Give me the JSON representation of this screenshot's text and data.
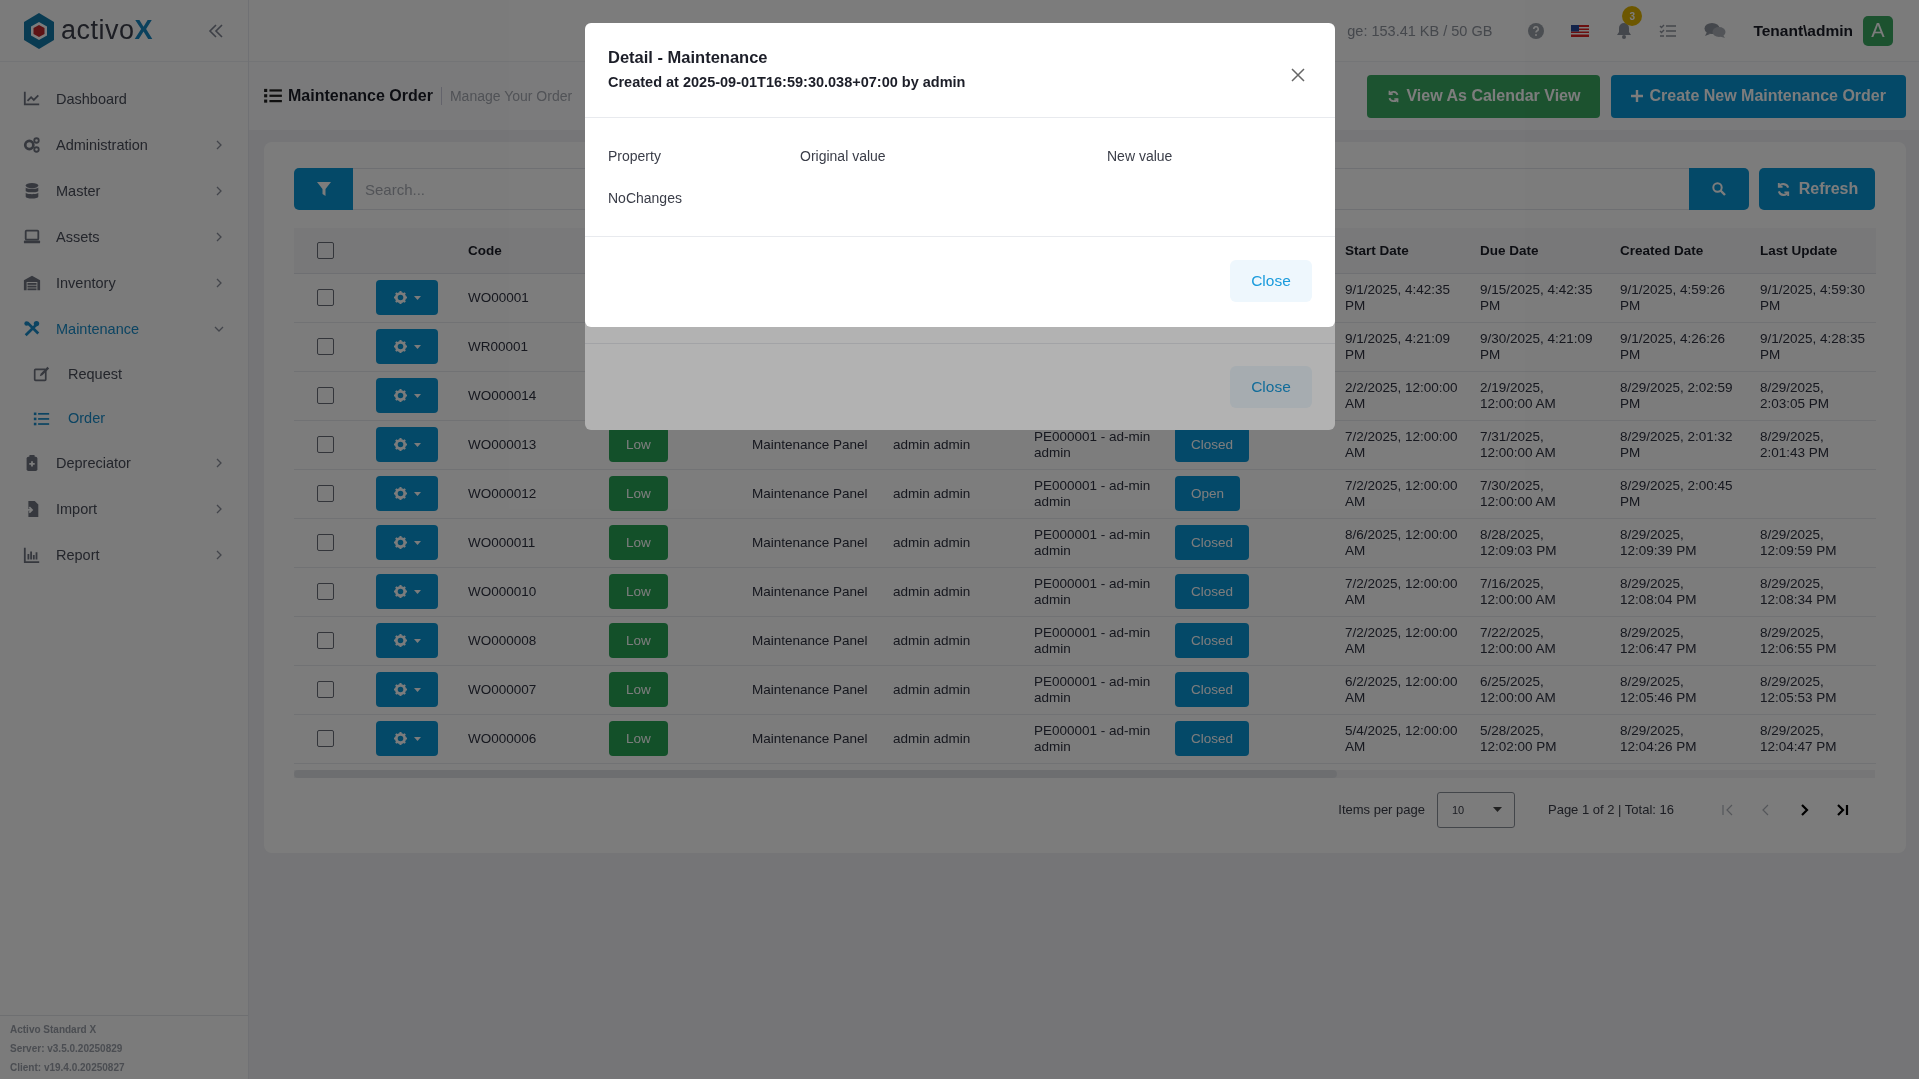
{
  "sidebar": {
    "logo": {
      "text": "activo",
      "accent": "X"
    },
    "items": [
      {
        "label": "Dashboard",
        "selected": false
      },
      {
        "label": "Administration",
        "selected": false,
        "expanded": false
      },
      {
        "label": "Master",
        "selected": false,
        "expanded": false
      },
      {
        "label": "Assets",
        "selected": false,
        "expanded": false
      },
      {
        "label": "Inventory",
        "selected": false,
        "expanded": false
      },
      {
        "label": "Maintenance",
        "selected": true,
        "expanded": true,
        "children": [
          {
            "label": "Request",
            "selected": false
          },
          {
            "label": "Order",
            "selected": true
          }
        ]
      },
      {
        "label": "Depreciator",
        "selected": false,
        "expanded": false
      },
      {
        "label": "Import",
        "selected": false,
        "expanded": false
      },
      {
        "label": "Report",
        "selected": false,
        "expanded": false
      }
    ],
    "footer": [
      "Activo Standard X",
      "Server: v3.5.0.20250829",
      "Client: v19.4.0.20250827"
    ]
  },
  "header": {
    "storage": "ge: 153.41 KB / 50 GB",
    "notifications": "3",
    "user": "Tenant\\admin",
    "avatar": "A"
  },
  "page": {
    "title": "Maintenance Order",
    "subtitle": "Manage Your Order",
    "buttons": [
      {
        "label": "View As Calendar View",
        "kind": "calendar"
      },
      {
        "label": "Create New Maintenance Order",
        "kind": "create"
      }
    ]
  },
  "toolbar": {
    "placeholder": "Search...",
    "refresh": "Refresh"
  },
  "table": {
    "select_all": {
      "checked": false
    },
    "code_column": "Code",
    "date_columns": [
      "Start Date",
      "Due Date",
      "Created Date",
      "Last Update"
    ],
    "rows": [
      {
        "checked": false,
        "code": "WO00001",
        "start": "9/1/2025, 4:42:35 PM",
        "due": "9/15/2025, 4:42:35 PM",
        "created": "9/1/2025, 4:59:26 PM",
        "updated": "9/1/2025, 4:59:30 PM"
      },
      {
        "checked": false,
        "code": "WR00001",
        "start": "9/1/2025, 4:21:09 PM",
        "due": "9/30/2025, 4:21:09 PM",
        "created": "9/1/2025, 4:26:26 PM",
        "updated": "9/1/2025, 4:28:35 PM"
      },
      {
        "checked": false,
        "code": "WO000014",
        "start": "2/2/2025, 12:00:00 AM",
        "due": "2/19/2025, 12:00:00 AM",
        "created": "8/29/2025, 2:02:59 PM",
        "updated": "8/29/2025, 2:03:05 PM"
      },
      {
        "checked": false,
        "code": "WO000013",
        "priority": "Low",
        "type": "Maintenance Panel",
        "requester": "admin admin",
        "assignee": "PE000001 - ad-min admin",
        "status": "Closed",
        "start": "7/2/2025, 12:00:00 AM",
        "due": "7/31/2025, 12:00:00 AM",
        "created": "8/29/2025, 2:01:32 PM",
        "updated": "8/29/2025, 2:01:43 PM"
      },
      {
        "checked": false,
        "code": "WO000012",
        "priority": "Low",
        "type": "Maintenance Panel",
        "requester": "admin admin",
        "assignee": "PE000001 - ad-min admin",
        "status": "Open",
        "start": "7/2/2025, 12:00:00 AM",
        "due": "7/30/2025, 12:00:00 AM",
        "created": "8/29/2025, 2:00:45 PM"
      },
      {
        "checked": false,
        "code": "WO000011",
        "priority": "Low",
        "type": "Maintenance Panel",
        "requester": "admin admin",
        "assignee": "PE000001 - ad-min admin",
        "status": "Closed",
        "start": "8/6/2025, 12:00:00 AM",
        "due": "8/28/2025, 12:09:03 PM",
        "created": "8/29/2025, 12:09:39 PM",
        "updated": "8/29/2025, 12:09:59 PM"
      },
      {
        "checked": false,
        "code": "WO000010",
        "priority": "Low",
        "type": "Maintenance Panel",
        "requester": "admin admin",
        "assignee": "PE000001 - ad-min admin",
        "status": "Closed",
        "start": "7/2/2025, 12:00:00 AM",
        "due": "7/16/2025, 12:00:00 AM",
        "created": "8/29/2025, 12:08:04 PM",
        "updated": "8/29/2025, 12:08:34 PM"
      },
      {
        "checked": false,
        "code": "WO000008",
        "priority": "Low",
        "type": "Maintenance Panel",
        "requester": "admin admin",
        "assignee": "PE000001 - ad-min admin",
        "status": "Closed",
        "start": "7/2/2025, 12:00:00 AM",
        "due": "7/22/2025, 12:00:00 AM",
        "created": "8/29/2025, 12:06:47 PM",
        "updated": "8/29/2025, 12:06:55 PM"
      },
      {
        "checked": false,
        "code": "WO000007",
        "priority": "Low",
        "type": "Maintenance Panel",
        "requester": "admin admin",
        "assignee": "PE000001 - ad-min admin",
        "status": "Closed",
        "start": "6/2/2025, 12:00:00 AM",
        "due": "6/25/2025, 12:00:00 AM",
        "created": "8/29/2025, 12:05:46 PM",
        "updated": "8/29/2025, 12:05:53 PM"
      },
      {
        "checked": false,
        "code": "WO000006",
        "priority": "Low",
        "type": "Maintenance Panel",
        "requester": "admin admin",
        "assignee": "PE000001 - ad-min admin",
        "status": "Closed",
        "start": "5/4/2025, 12:00:00 AM",
        "due": "5/28/2025, 12:02:00 PM",
        "created": "8/29/2025, 12:04:26 PM",
        "updated": "8/29/2025, 12:04:47 PM"
      }
    ]
  },
  "pagination": {
    "label": "Items per page",
    "per_page": "10",
    "summary": "Page 1 of 2 | Total: 16",
    "nav": [
      {
        "kind": "first",
        "disabled": true
      },
      {
        "kind": "prev",
        "disabled": true
      },
      {
        "kind": "next",
        "disabled": false
      },
      {
        "kind": "last",
        "disabled": false
      }
    ]
  },
  "dialogs": [
    {
      "kind": "front",
      "title": "Detail - Maintenance",
      "subtitle": "Created at 2025-09-01T16:59:30.038+07:00 by admin",
      "columns": [
        "Property",
        "Original value",
        "New value"
      ],
      "message": "NoChanges",
      "close": "Close"
    },
    {
      "kind": "back",
      "close": "Close"
    }
  ]
}
